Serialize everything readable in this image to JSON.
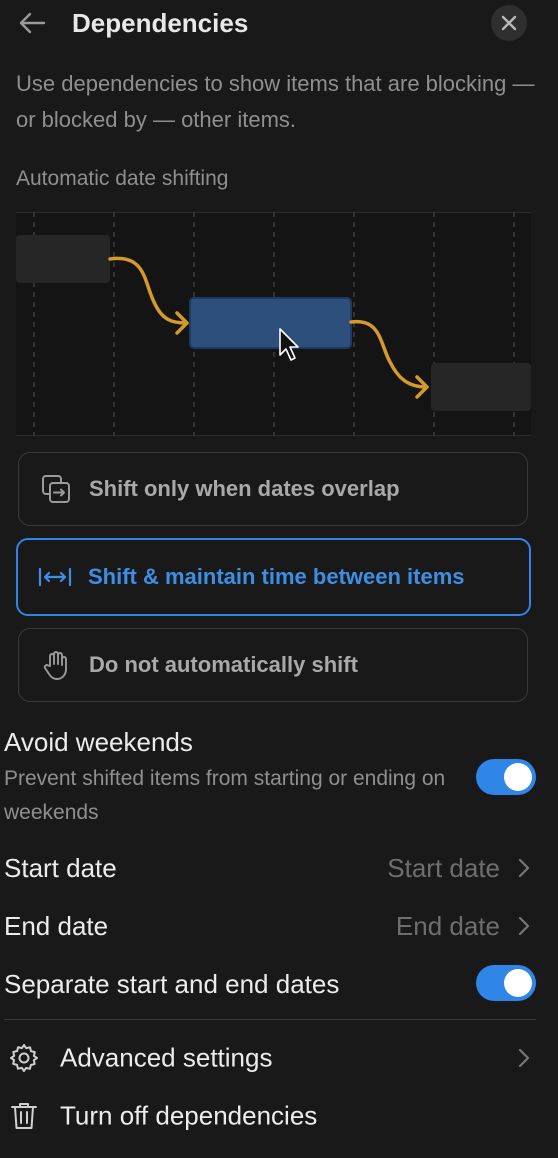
{
  "header": {
    "title": "Dependencies",
    "back_icon": "arrow-left-icon",
    "close_icon": "close-icon"
  },
  "description": "Use dependencies to show items that are blocking — or blocked by — other items.",
  "section_label": "Automatic date shifting",
  "options": [
    {
      "label": "Shift only when dates overlap",
      "icon": "overlap-icon",
      "selected": false
    },
    {
      "label": "Shift & maintain time between items",
      "icon": "shift-maintain-icon",
      "selected": true
    },
    {
      "label": "Do not automatically shift",
      "icon": "hand-icon",
      "selected": false
    }
  ],
  "avoid_weekends": {
    "title": "Avoid weekends",
    "subtitle": "Prevent shifted items from starting or ending on weekends",
    "enabled": true
  },
  "start_date": {
    "label": "Start date",
    "value": "Start date"
  },
  "end_date": {
    "label": "End date",
    "value": "End date"
  },
  "separate_dates": {
    "label": "Separate start and end dates",
    "enabled": true
  },
  "actions": {
    "advanced": {
      "label": "Advanced settings",
      "icon": "gear-icon"
    },
    "turn_off": {
      "label": "Turn off dependencies",
      "icon": "trash-icon"
    }
  },
  "colors": {
    "accent": "#2f86e6",
    "arrow": "#d49a2a",
    "highlight_bar": "#2d4f7c",
    "background": "#191919"
  }
}
